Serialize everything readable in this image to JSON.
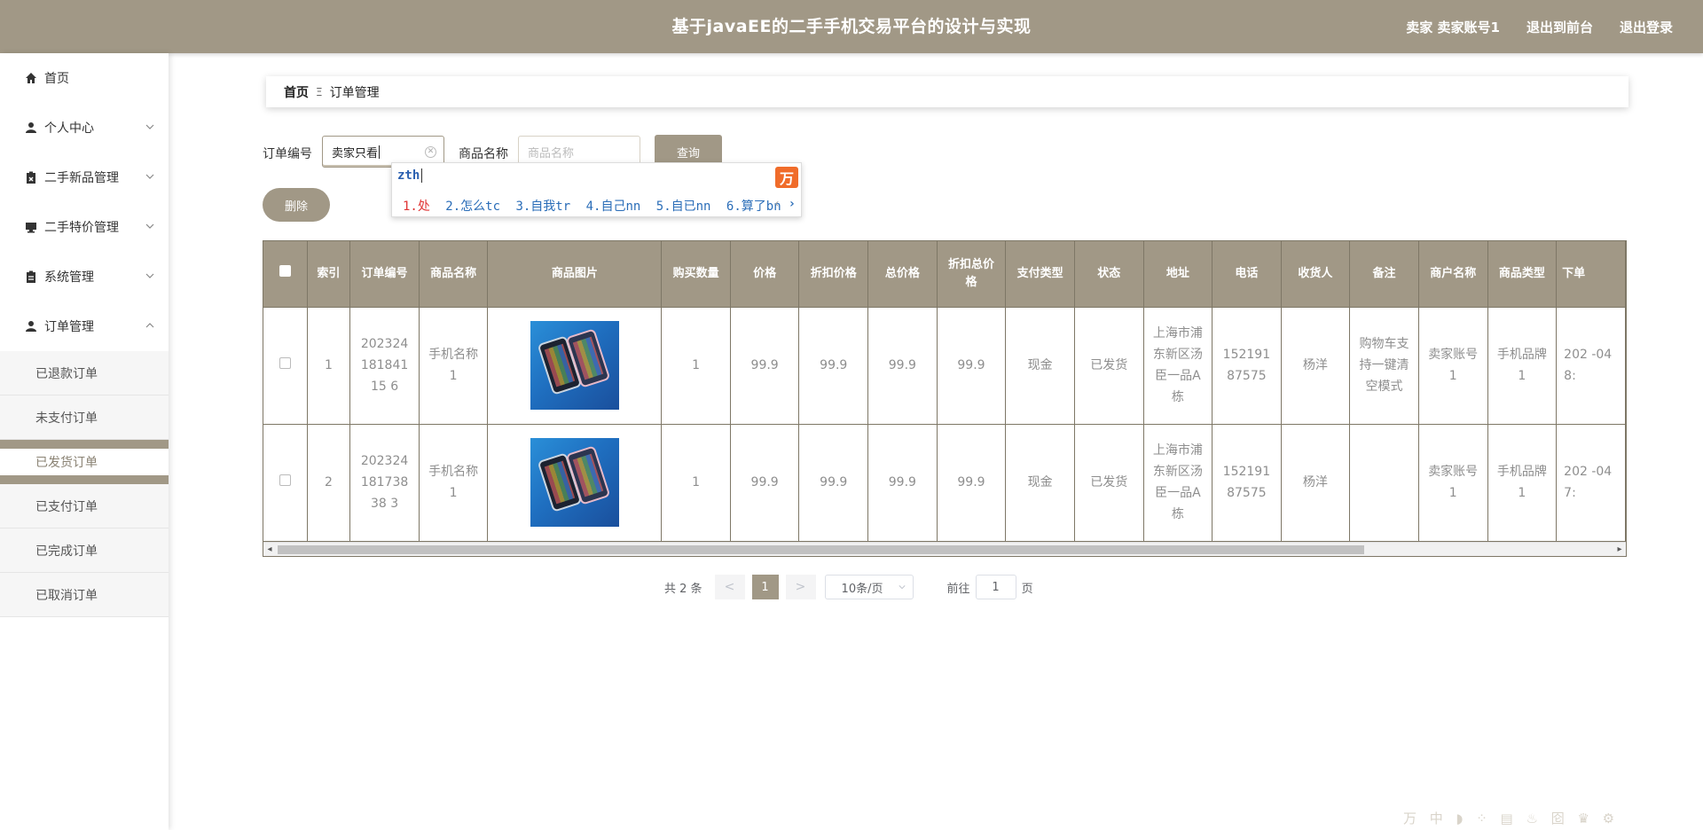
{
  "header": {
    "title": "基于javaEE的二手手机交易平台的设计与实现",
    "user": "卖家 卖家账号1",
    "to_front": "退出到前台",
    "logout": "退出登录"
  },
  "sidebar": {
    "items": [
      {
        "label": "首页",
        "icon": "home-icon"
      },
      {
        "label": "个人中心",
        "icon": "user-icon"
      },
      {
        "label": "二手新品管理",
        "icon": "clipboard-x-icon"
      },
      {
        "label": "二手特价管理",
        "icon": "monitor-icon"
      },
      {
        "label": "系统管理",
        "icon": "clipboard-icon"
      },
      {
        "label": "订单管理",
        "icon": "user-icon"
      }
    ],
    "order_submenu": [
      "已退款订单",
      "未支付订单",
      "已发货订单",
      "已支付订单",
      "已完成订单",
      "已取消订单"
    ],
    "active_submenu": "已发货订单"
  },
  "breadcrumb": {
    "home": "首页",
    "separator": "Ξ",
    "current": "订单管理"
  },
  "search": {
    "order_no_label": "订单编号",
    "order_no_value": "卖家只看",
    "product_name_label": "商品名称",
    "product_name_placeholder": "商品名称",
    "query_button": "查询",
    "delete_button": "删除"
  },
  "ime": {
    "typed": "zth",
    "candidates": [
      "1.处",
      "2.怎么tc",
      "3.自我tr",
      "4.自己nn",
      "5.自已nn",
      "6.算了bn"
    ],
    "logo": "万"
  },
  "table": {
    "headers": [
      "索引",
      "订单编号",
      "商品名称",
      "商品图片",
      "购买数量",
      "价格",
      "折扣价格",
      "总价格",
      "折扣总价格",
      "支付类型",
      "状态",
      "地址",
      "电话",
      "收货人",
      "备注",
      "商户名称",
      "商品类型",
      "下单"
    ],
    "rows": [
      {
        "index": "1",
        "order_no": "20232418184115 6",
        "product": "手机名称1",
        "qty": "1",
        "price": "99.9",
        "discount_price": "99.9",
        "total": "99.9",
        "discount_total": "99.9",
        "pay_type": "现金",
        "status": "已发货",
        "address": "上海市浦东新区汤臣一品A栋",
        "phone": "15219187575",
        "receiver": "杨洋",
        "remark": "购物车支持一键清空模式",
        "merchant": "卖家账号1",
        "type": "手机品牌1",
        "date": "202 -04 8:"
      },
      {
        "index": "2",
        "order_no": "20232418173838 3",
        "product": "手机名称1",
        "qty": "1",
        "price": "99.9",
        "discount_price": "99.9",
        "total": "99.9",
        "discount_total": "99.9",
        "pay_type": "现金",
        "status": "已发货",
        "address": "上海市浦东新区汤臣一品A栋",
        "phone": "15219187575",
        "receiver": "杨洋",
        "remark": "",
        "merchant": "卖家账号1",
        "type": "手机品牌1",
        "date": "202 -04 7:"
      }
    ]
  },
  "pagination": {
    "total": "共 2 条",
    "prev": "<",
    "page": "1",
    "next": ">",
    "page_size": "10条/页",
    "goto_prefix": "前往",
    "goto_value": "1",
    "goto_suffix": "页"
  },
  "ime_toolbar": "万 中 ◗ ⁘ ▤ ♨ 囵 ♛ ⚙"
}
